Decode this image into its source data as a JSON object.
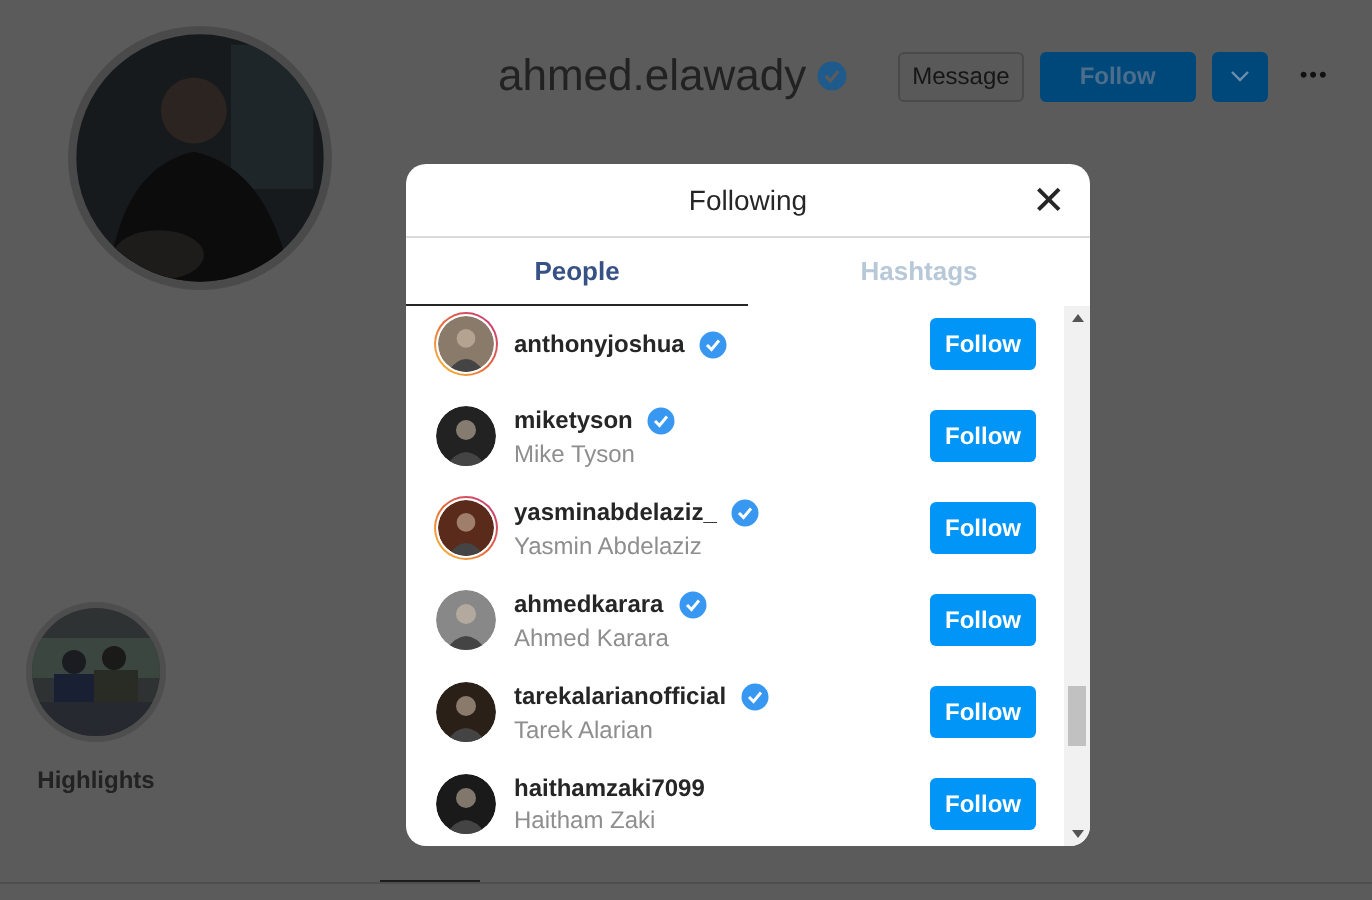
{
  "profile": {
    "username": "ahmed.elawady",
    "verified": true,
    "message_button": "Message",
    "follow_button": "Follow",
    "more_icon": "•••"
  },
  "highlights": [
    {
      "title": "Highlights"
    }
  ],
  "modal": {
    "title": "Following",
    "close": "✕",
    "tabs": [
      {
        "label": "People",
        "selected": true
      },
      {
        "label": "Hashtags",
        "selected": false
      }
    ],
    "accounts": [
      {
        "username": "anthonyjoshua",
        "verified": true,
        "story_ring": true,
        "button": "Follow"
      },
      {
        "username": "miketyson",
        "full_name": "Mike Tyson",
        "verified": true,
        "story_ring": false,
        "button": "Follow"
      },
      {
        "username": "yasminabdelaziz_",
        "full_name": "Yasmin Abdelaziz",
        "verified": true,
        "story_ring": true,
        "button": "Follow"
      },
      {
        "username": "ahmedkarara",
        "full_name": "Ahmed Karara",
        "verified": true,
        "story_ring": false,
        "button": "Follow"
      },
      {
        "username": "tarekalarianofficial",
        "full_name": "Tarek Alarian",
        "verified": true,
        "story_ring": false,
        "button": "Follow"
      },
      {
        "username": "haithamzaki7099",
        "full_name": "Haitham Zaki",
        "verified": false,
        "story_ring": false,
        "button": "Follow"
      }
    ]
  }
}
